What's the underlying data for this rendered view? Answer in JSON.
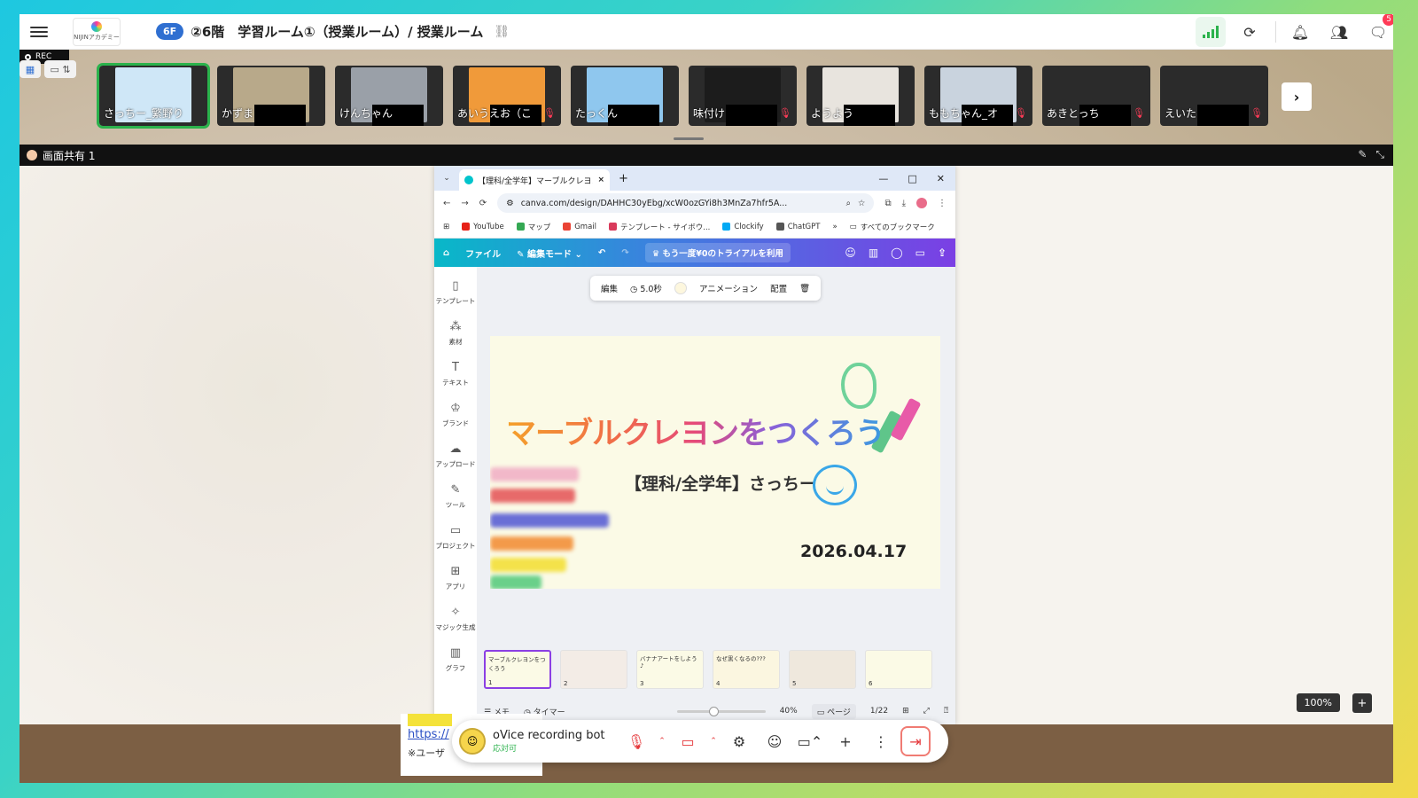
{
  "app": {
    "floor_badge": "6F",
    "room_title": "②6階　学習ルーム①（授業ルーム）/ 授業ルーム",
    "logo_text": "NIJINアカデミー",
    "notification_count": "5",
    "rec_label": "REC"
  },
  "participants": [
    {
      "name": "さっちー_繁野り",
      "active": true,
      "color": "#cfe7f7",
      "muted": false
    },
    {
      "name": "かずま",
      "active": false,
      "color": "#b8a98a",
      "muted": false
    },
    {
      "name": "けんちゃん",
      "active": false,
      "color": "#9aa0a8",
      "muted": false
    },
    {
      "name": "あいうえお（こ",
      "active": false,
      "color": "#f09a3a",
      "muted": true
    },
    {
      "name": "たっくん",
      "active": false,
      "color": "#8fc7ee",
      "muted": false
    },
    {
      "name": "味付け",
      "active": false,
      "color": "#1c1c1c",
      "muted": true
    },
    {
      "name": "ようよう",
      "active": false,
      "color": "#e8e4de",
      "muted": false
    },
    {
      "name": "ももちゃん_オ",
      "active": false,
      "color": "#c9d3de",
      "muted": true
    },
    {
      "name": "あきとっち",
      "active": false,
      "color": "#2b2b2b",
      "muted": true
    },
    {
      "name": "えいた",
      "active": false,
      "color": "#2b2b2b",
      "muted": true
    }
  ],
  "share": {
    "label": "画面共有 1"
  },
  "browser": {
    "tab_title": "【理科/全学年】マーブルクレヨンを",
    "url": "canva.com/design/DAHHC30yEbg/xcW0ozGYi8h3MnZa7hfr5A...",
    "bookmarks": [
      {
        "label": "YouTube",
        "color": "#e62117"
      },
      {
        "label": "マップ",
        "color": "#34a853"
      },
      {
        "label": "Gmail",
        "color": "#ea4335"
      },
      {
        "label": "テンプレート - サイボウ...",
        "color": "#d93a5b"
      },
      {
        "label": "Clockify",
        "color": "#03a9f4"
      },
      {
        "label": "ChatGPT",
        "color": "#555555"
      }
    ],
    "bookmarks_all": "すべてのブックマーク"
  },
  "canva": {
    "file": "ファイル",
    "mode": "編集モード",
    "trial": "もう一度¥0のトライアルを利用",
    "toolbar": {
      "edit": "編集",
      "duration": "5.0秒",
      "animation": "アニメーション",
      "arrange": "配置"
    },
    "nav": [
      {
        "label": "テンプレート",
        "icon": "template-icon",
        "glyph": "▯"
      },
      {
        "label": "素材",
        "icon": "elements-icon",
        "glyph": "⁂"
      },
      {
        "label": "テキスト",
        "icon": "text-icon",
        "glyph": "T"
      },
      {
        "label": "ブランド",
        "icon": "brand-icon",
        "glyph": "♔"
      },
      {
        "label": "アップロード",
        "icon": "upload-icon",
        "glyph": "☁"
      },
      {
        "label": "ツール",
        "icon": "tools-icon",
        "glyph": "✎"
      },
      {
        "label": "プロジェクト",
        "icon": "folder-icon",
        "glyph": "▭"
      },
      {
        "label": "アプリ",
        "icon": "apps-icon",
        "glyph": "⊞"
      },
      {
        "label": "マジック生成",
        "icon": "magic-icon",
        "glyph": "✧"
      },
      {
        "label": "グラフ",
        "icon": "chart-icon",
        "glyph": "▥"
      }
    ],
    "slide": {
      "title": "マーブルクレヨンをつくろう",
      "subtitle": "【理科/全学年】さっちー",
      "date": "2026.04.17"
    },
    "thumbnails": [
      {
        "num": "1",
        "text": "マーブルクレヨンをつくろう"
      },
      {
        "num": "2",
        "text": ""
      },
      {
        "num": "3",
        "text": "バナナアートをしよう♪"
      },
      {
        "num": "4",
        "text": "なぜ黒くなるの???"
      },
      {
        "num": "5",
        "text": ""
      },
      {
        "num": "6",
        "text": ""
      }
    ],
    "footer": {
      "memo": "メモ",
      "timer": "タイマー",
      "zoom": "40%",
      "page": "ページ",
      "page_count": "1/22"
    }
  },
  "room_zoom": "100%",
  "lower_card": {
    "link": "https://",
    "note": "※ユーザ"
  },
  "bot": {
    "name": "oVice recording bot",
    "status": "応対可"
  }
}
